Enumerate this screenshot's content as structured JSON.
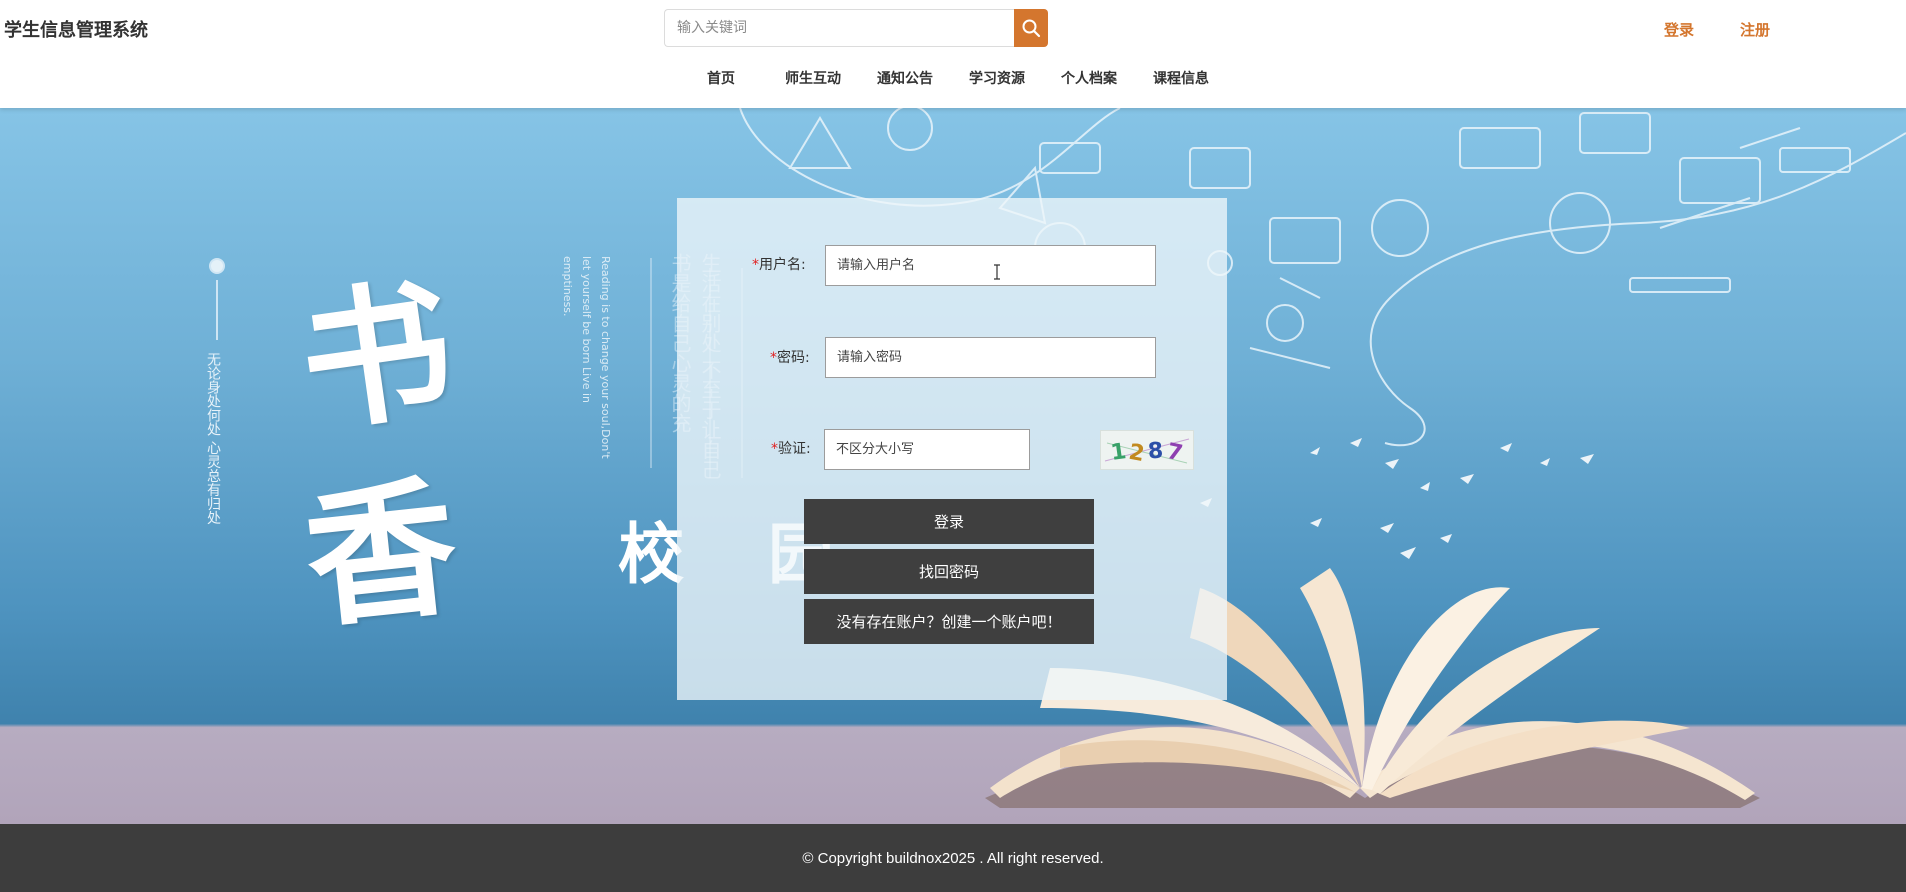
{
  "header": {
    "site_title": "学生信息管理系统",
    "search_placeholder": "输入关键词",
    "login_link": "登录",
    "register_link": "注册"
  },
  "nav": {
    "items": [
      "首页",
      "师生互动",
      "通知公告",
      "学习资源",
      "个人档案",
      "课程信息"
    ]
  },
  "hero": {
    "calligraphy_1": "书",
    "calligraphy_2": "香",
    "calligraphy_3": "校",
    "calligraphy_4": "园",
    "vertical_poem": "无论身处何处 心灵总有归处",
    "vertical_en": "Reading is to change your soul,Don't let yourself be born Live in emptiness.",
    "vertical_cn_2": "生活在别处 不至于让自己 书是给自己心灵的充"
  },
  "login_form": {
    "username_label": "用户名:",
    "username_placeholder": "请输入用户名",
    "password_label": "密码:",
    "password_placeholder": "请输入密码",
    "captcha_label": "验证:",
    "captcha_placeholder": "不区分大小写",
    "captcha_text": "1287",
    "required_mark": "*",
    "login_button": "登录",
    "recover_button": "找回密码",
    "signup_button": "没有存在账户？创建一个账户吧！"
  },
  "footer": {
    "copyright": "© Copyright buildnox2025 . All right reserved."
  },
  "colors": {
    "accent": "#d4762e",
    "dark_button": "#3f3f3f",
    "footer_bg": "#3d3d3d",
    "required": "#e02020"
  },
  "icons": {
    "search": "search-icon",
    "captcha": "captcha-image"
  }
}
